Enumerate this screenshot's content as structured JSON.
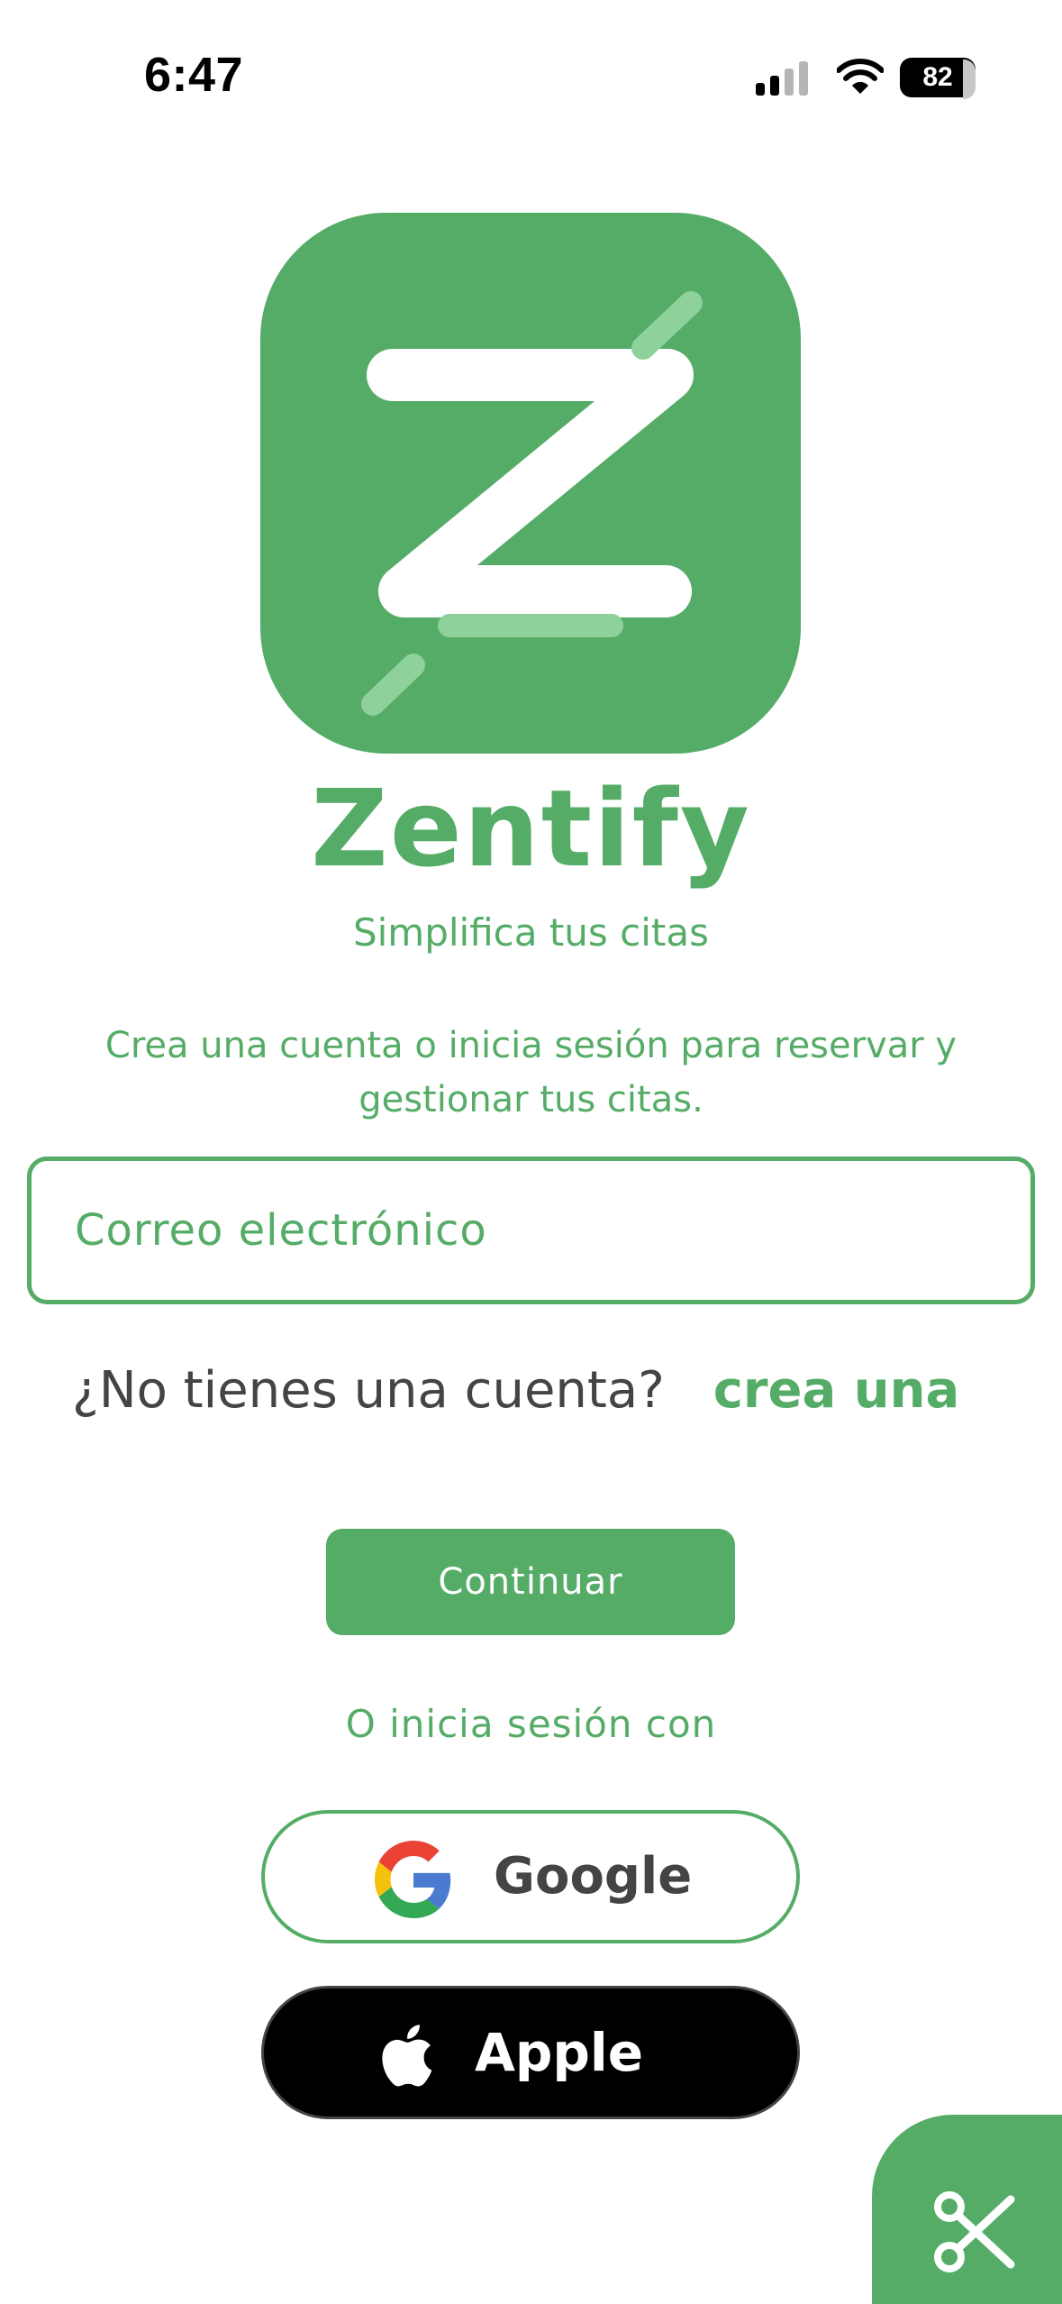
{
  "status_bar": {
    "time": "6:47",
    "battery_level": "82"
  },
  "brand": {
    "name": "Zentify",
    "tagline": "Simplifica tus citas",
    "color": "#55ac67"
  },
  "intro": {
    "description": "Crea una cuenta o inicia sesión para reservar y gestionar tus citas."
  },
  "email_field": {
    "placeholder": "Correo electrónico",
    "value": ""
  },
  "signup": {
    "question": "¿No tienes una cuenta?",
    "link": "crea una"
  },
  "continue_button": {
    "label": "Continuar"
  },
  "social": {
    "divider_label": "O inicia sesión con",
    "google_label": "Google",
    "apple_label": "Apple"
  },
  "icons": {
    "logo": "zentify-z-logo",
    "fab": "scissors-icon"
  }
}
